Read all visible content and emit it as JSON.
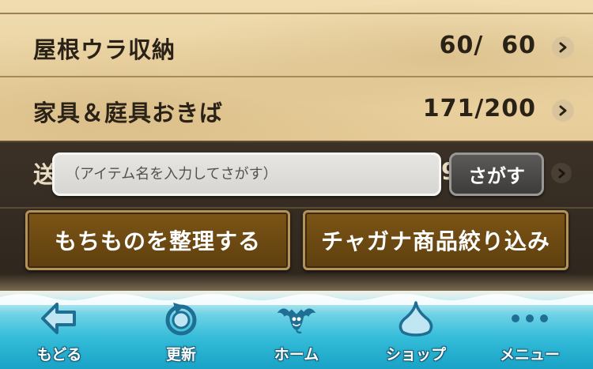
{
  "storage_rows": [
    {
      "label": "屋根ウラ収納",
      "count": "60/  60"
    },
    {
      "label": "家具＆庭具おきば",
      "count": "171/200"
    }
  ],
  "hidden_row": {
    "label_fragment": "送",
    "count_fragment": "9"
  },
  "search": {
    "placeholder": "（アイテム名を入力してさがす）",
    "button_label": "さがす"
  },
  "actions": {
    "organize_label": "もちものを整理する",
    "filter_label": "チャガナ商品絞り込み"
  },
  "nav": [
    {
      "label": "もどる",
      "icon": "back-arrow-icon"
    },
    {
      "label": "更新",
      "icon": "refresh-icon"
    },
    {
      "label": "ホーム",
      "icon": "dracky-home-icon"
    },
    {
      "label": "ショップ",
      "icon": "slime-shop-icon"
    },
    {
      "label": "メニュー",
      "icon": "menu-dots-icon"
    }
  ],
  "colors": {
    "parchment": "#ead3a2",
    "dark_band": "#2e261d",
    "action_button": "#6c4912",
    "nav_sea": "#34bcd9",
    "nav_icon": "#1e6f93"
  }
}
